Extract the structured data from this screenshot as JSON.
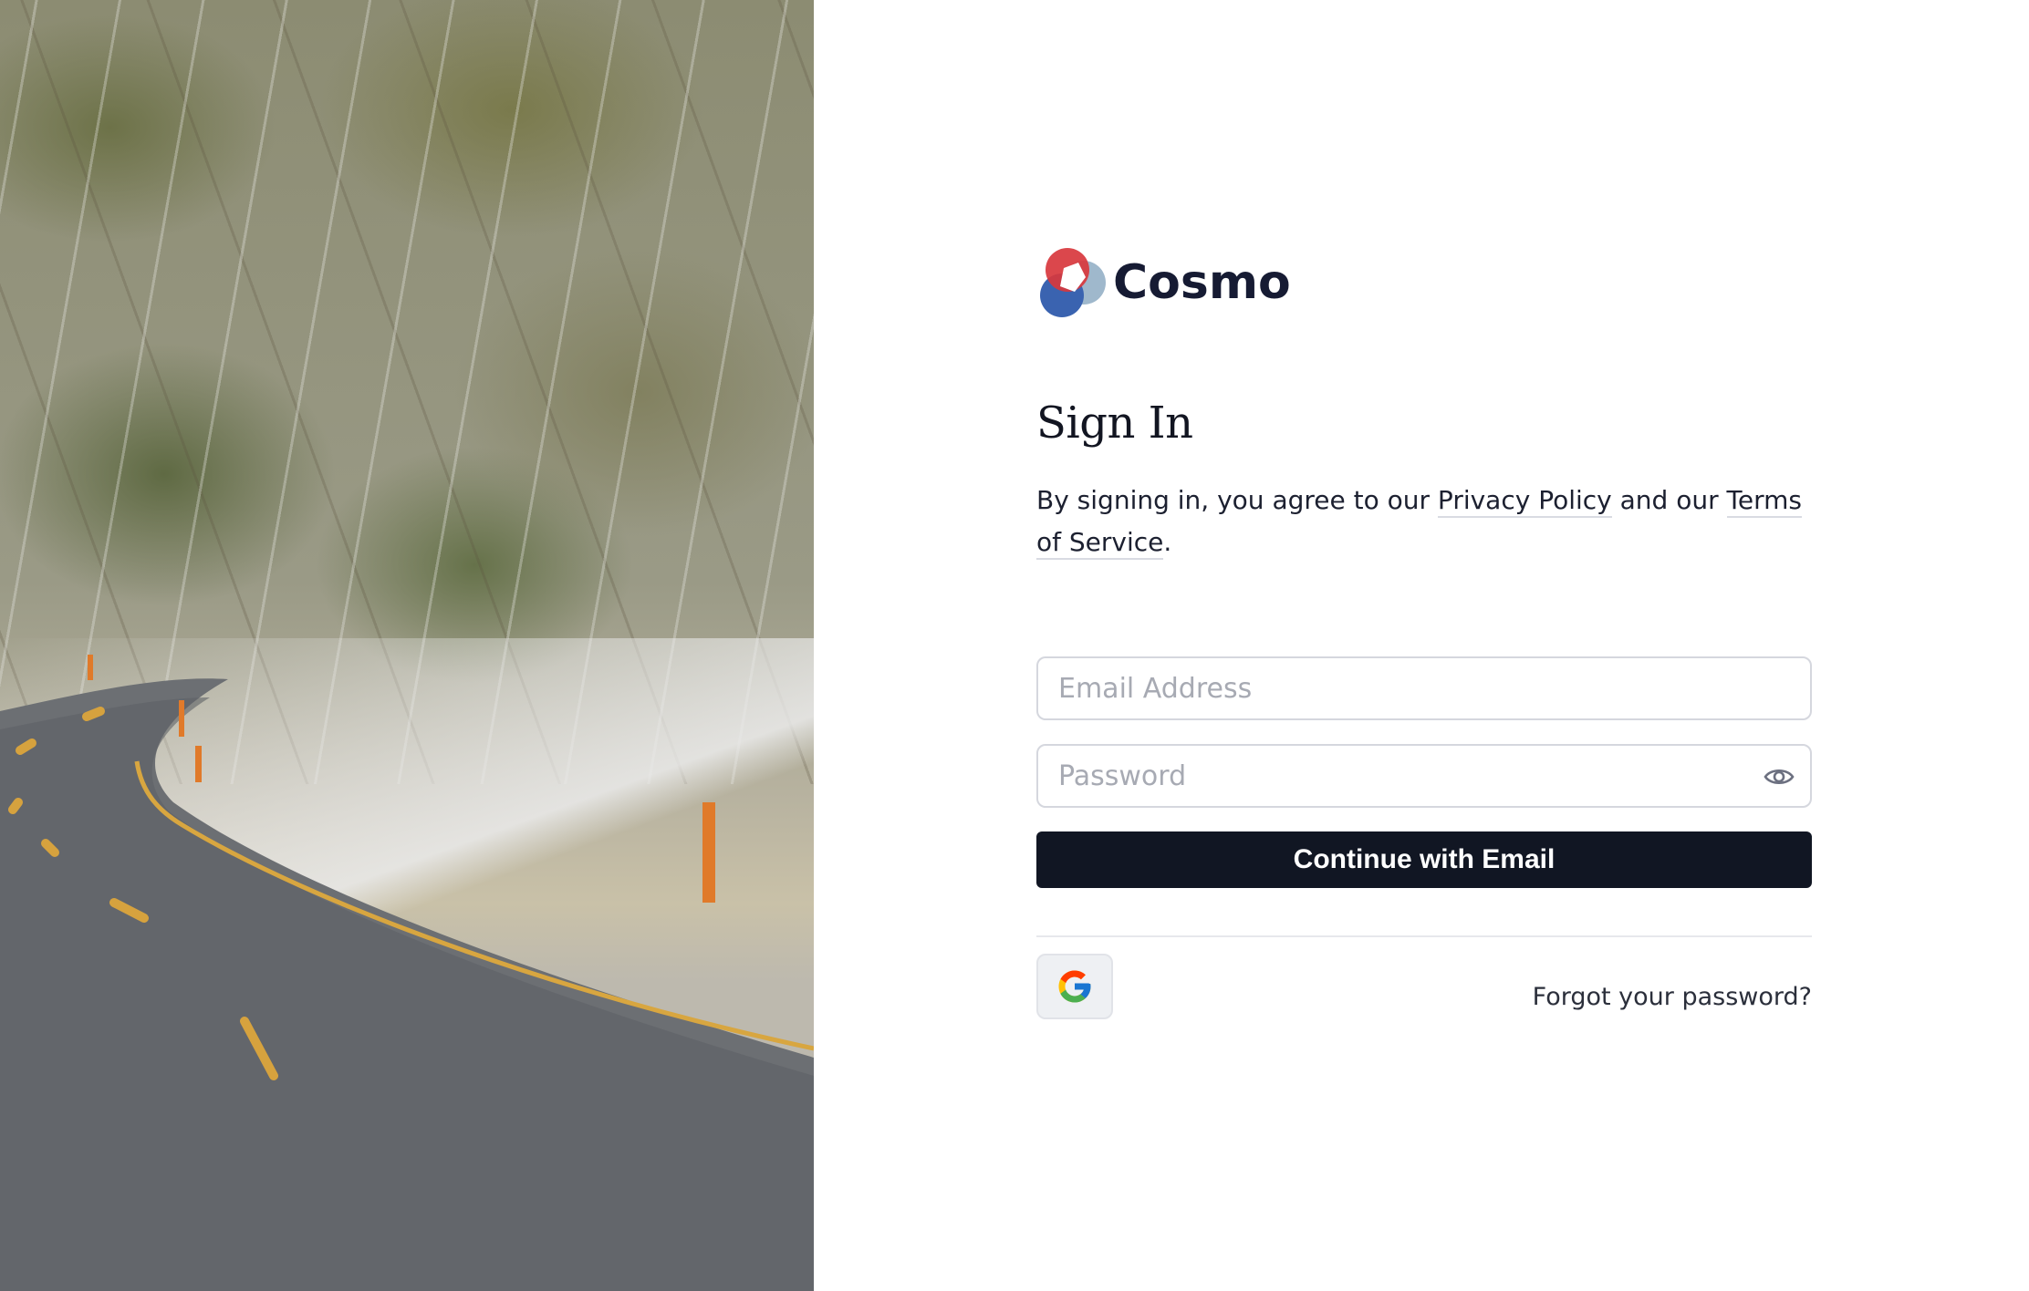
{
  "brand": {
    "name": "Cosmo",
    "logo_icon": "cosmo-logo-icon"
  },
  "hero": {
    "image_icon": "snowy-road-photo"
  },
  "signin": {
    "title": "Sign In",
    "agree_prefix": "By signing in, you agree to our ",
    "privacy_link": "Privacy Policy",
    "agree_middle": " and our ",
    "terms_link": "Terms of Service",
    "agree_suffix": "."
  },
  "form": {
    "email": {
      "value": "",
      "placeholder": "Email Address"
    },
    "password": {
      "value": "",
      "placeholder": "Password",
      "toggle_icon": "eye-icon"
    },
    "submit_label": "Continue with Email"
  },
  "alternatives": {
    "google_icon": "google-icon",
    "forgot_label": "Forgot your password?"
  },
  "colors": {
    "primary_button": "#111623",
    "brand_text": "#161b33",
    "logo_red": "#d8373d",
    "logo_blue": "#3a63b0",
    "logo_light": "#9fb8cc"
  }
}
